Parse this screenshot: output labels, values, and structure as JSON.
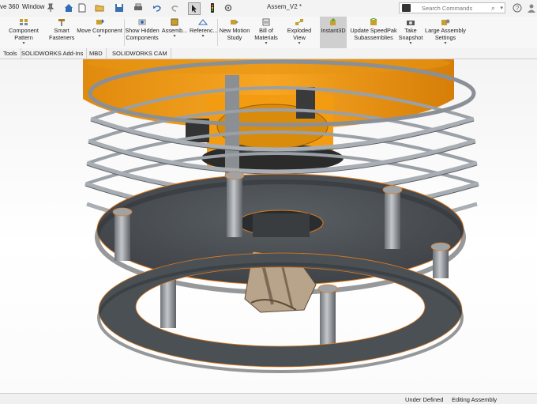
{
  "titlebar": {
    "menu_items": [
      "ve 360",
      "Window"
    ],
    "doc_title": "Assem_V2 *",
    "search_placeholder": "Search Commands",
    "icons": [
      "home-icon",
      "new-document-icon",
      "open-icon",
      "save-icon",
      "print-icon",
      "undo-icon",
      "redo-icon",
      "select-icon",
      "traffic-light-icon",
      "options-icon",
      "pin-icon",
      "help-icon",
      "user-icon"
    ]
  },
  "ribbon": {
    "buttons": [
      {
        "label": "Component Pattern",
        "has_caret": true
      },
      {
        "label": "Smart Fasteners",
        "has_caret": false
      },
      {
        "label": "Move Component",
        "has_caret": true
      },
      {
        "label": "Show Hidden Components",
        "has_caret": false
      },
      {
        "label": "Assemb...",
        "has_caret": true
      },
      {
        "label": "Referenc...",
        "has_caret": true
      },
      {
        "label": "New Motion Study",
        "has_caret": false
      },
      {
        "label": "Bill of Materials",
        "has_caret": true
      },
      {
        "label": "Exploded View",
        "has_caret": true
      },
      {
        "label": "Instant3D",
        "has_caret": false,
        "active": true
      },
      {
        "label": "Update SpeedPak Subassemblies",
        "has_caret": false
      },
      {
        "label": "Take Snapshot",
        "has_caret": true
      },
      {
        "label": "Large Assembly Settings",
        "has_caret": true
      }
    ]
  },
  "tabs": [
    "Tools",
    "SOLIDWORKS Add-Ins",
    "MBD",
    "SOLIDWORKS CAM"
  ],
  "status": {
    "units": "Under Defined",
    "mode": "Editing Assembly"
  },
  "colors": {
    "accent_orange": "#f39c12",
    "ribbon_bg": "#f7f7f7",
    "metal_dark": "#4a4f55",
    "metal_light": "#b8bcc0",
    "active_button": "#cfcfcf"
  }
}
